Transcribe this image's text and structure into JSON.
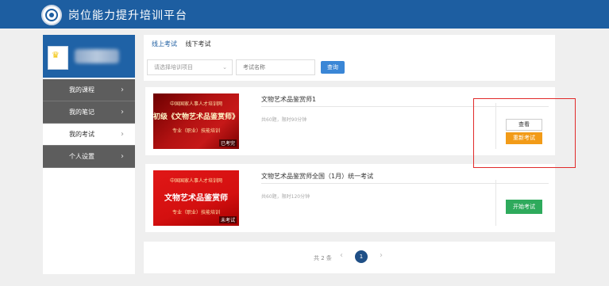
{
  "header": {
    "title": "岗位能力提升培训平台"
  },
  "sidebar": {
    "items": [
      {
        "label": "我的课程"
      },
      {
        "label": "我的笔记"
      },
      {
        "label": "我的考试"
      },
      {
        "label": "个人设置"
      }
    ],
    "active_index": 2,
    "chevron": "›"
  },
  "tabs": [
    {
      "label": "线上考试"
    },
    {
      "label": "线下考试"
    }
  ],
  "filters": {
    "project_select": "请选择培训项目",
    "exam_name_placeholder": "考试名称",
    "query_button": "查询"
  },
  "exams": [
    {
      "title": "文物艺术品鉴赏师1",
      "meta": "共60题，限时90分钟",
      "thumb_line1": "中国国家人事人才培训网",
      "thumb_line2": "初级《文物艺术品鉴赏师》",
      "thumb_line3": "专业（职业）技能培训",
      "thumb_tag": "已考完",
      "view_button": "查看",
      "retake_button": "重新考试"
    },
    {
      "title": "文物艺术品鉴赏师全国（1月）统一考试",
      "meta": "共60题，限时120分钟",
      "thumb_line1": "中国国家人事人才培训网",
      "thumb_line2": "文物艺术品鉴赏师",
      "thumb_line3": "专业（职业）技能培训",
      "thumb_tag": "未考试",
      "start_button": "开始考试"
    }
  ],
  "pagination": {
    "total_text": "共 2 条",
    "current_page": "1",
    "prev": "‹",
    "next": "›"
  },
  "colors": {
    "header_bg": "#1d5ea1",
    "highlight_border": "#e12a2a",
    "retake_button": "#f29b18",
    "start_button": "#2eaa5c",
    "query_button": "#3a86d6"
  }
}
